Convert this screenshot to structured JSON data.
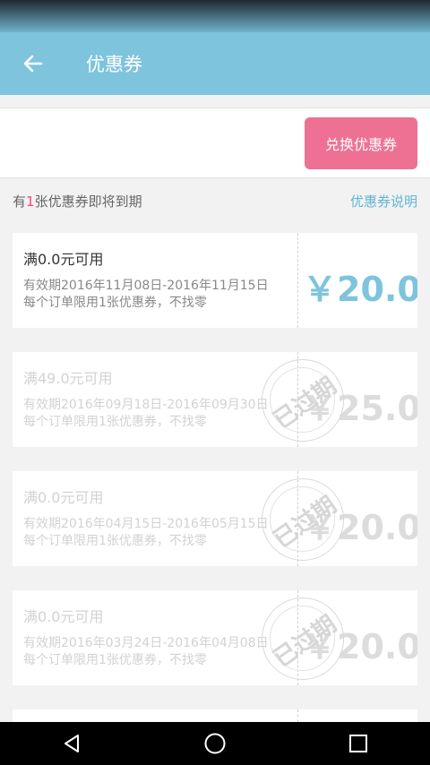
{
  "header": {
    "title": "优惠券"
  },
  "redeem": {
    "input_value": "",
    "button_label": "兑换优惠券"
  },
  "info": {
    "prefix": "有",
    "count": "1",
    "suffix": "张优惠券即将到期",
    "link": "优惠券说明"
  },
  "coupons": [
    {
      "condition": "满0.0元可用",
      "validity": "有效期2016年11月08日-2016年11月15日",
      "rule": "每个订单限用1张优惠券，不找零",
      "amount": "￥20.0",
      "status": "active"
    },
    {
      "condition": "满49.0元可用",
      "validity": "有效期2016年09月18日-2016年09月30日",
      "rule": "每个订单限用1张优惠券，不找零",
      "amount": "￥25.0",
      "status": "expired",
      "stamp": "已过期"
    },
    {
      "condition": "满0.0元可用",
      "validity": "有效期2016年04月15日-2016年05月15日",
      "rule": "每个订单限用1张优惠券，不找零",
      "amount": "￥20.0",
      "status": "expired",
      "stamp": "已过期"
    },
    {
      "condition": "满0.0元可用",
      "validity": "有效期2016年03月24日-2016年04月08日",
      "rule": "每个订单限用1张优惠券，不找零",
      "amount": "￥20.0",
      "status": "expired",
      "stamp": "已过期"
    }
  ],
  "icons": {
    "back": "arrow-left-icon",
    "nav_back": "triangle-back-icon",
    "nav_home": "circle-home-icon",
    "nav_recent": "square-recent-icon"
  },
  "colors": {
    "header": "#7ec4dd",
    "button": "#ee7193",
    "amount": "#7ec4dd",
    "highlight": "#ee4d6a"
  }
}
